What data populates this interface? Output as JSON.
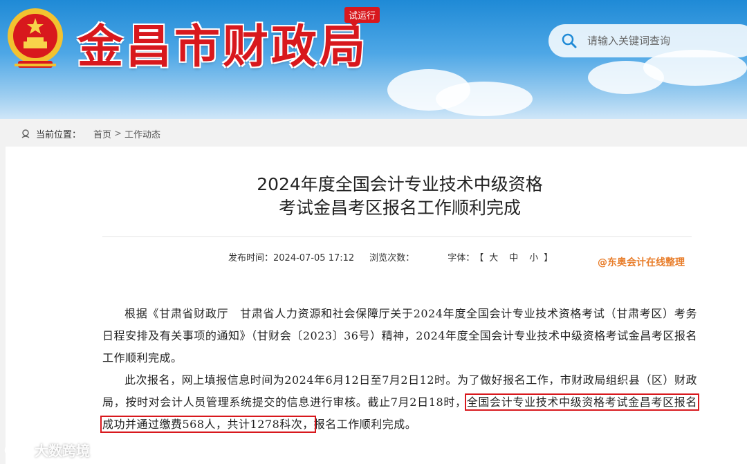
{
  "header": {
    "site_title": "金昌市财政局",
    "trial_badge": "试运行",
    "search_placeholder": "请输入关键词查询"
  },
  "breadcrumb": {
    "label": "当前位置：",
    "items": [
      "首页",
      "工作动态"
    ],
    "separator": ">"
  },
  "article": {
    "title_line1": "2024年度全国会计专业技术中级资格",
    "title_line2": "考试金昌考区报名工作顺利完成",
    "publish_label": "发布时间：",
    "publish_time": "2024-07-05 17:12",
    "views_label": "浏览次数：",
    "views_value": "",
    "font_label": "字体：",
    "font_open": "【",
    "font_large": "大",
    "font_medium": "中",
    "font_small": "小",
    "font_close": "】",
    "source_note": "@东奥会计在线整理",
    "para1": "根据《甘肃省财政厅　甘肃省人力资源和社会保障厅关于2024年度全国会计专业技术资格考试（甘肃考区）考务日程安排及有关事项的通知》（甘财会〔2023〕36号）精神，2024年度全国会计专业技术中级资格考试金昌考区报名工作顺利完成。",
    "para2_before": "此次报名，网上填报信息时间为2024年6月12日至7月2日12时。为了做好报名工作，市财政局组织县（区）财政局，按时对会计人员管理系统提交的信息进行审核。截止7月2日18时，",
    "para2_highlight": "全国会计专业技术中级资格考试金昌考区报名成功并通过缴费568人，共计1278科次，",
    "para2_after": "报名工作顺利完成。"
  },
  "corner_logo_text": "大数跨境",
  "colors": {
    "brand_red": "#d8181d",
    "note_orange": "#e87d2a",
    "banner_blue": "#1f8ad6"
  }
}
